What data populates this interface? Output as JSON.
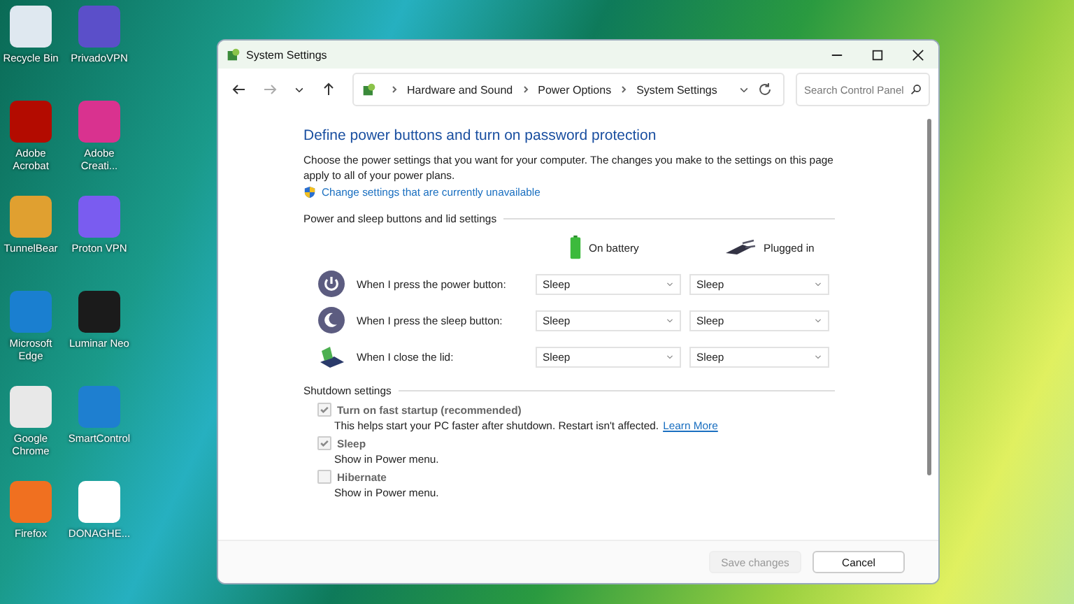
{
  "desktop": {
    "icons": [
      {
        "label": "Recycle Bin"
      },
      {
        "label": "PrivadoVPN"
      },
      {
        "label": "Adobe Acrobat"
      },
      {
        "label": "Adobe Creati..."
      },
      {
        "label": "TunnelBear"
      },
      {
        "label": "Proton VPN"
      },
      {
        "label": "Microsoft Edge"
      },
      {
        "label": "Luminar Neo"
      },
      {
        "label": "Google Chrome"
      },
      {
        "label": "SmartControl"
      },
      {
        "label": "Firefox"
      },
      {
        "label": "DONAGHE..."
      }
    ]
  },
  "window": {
    "title": "System Settings",
    "breadcrumb": [
      "Hardware and Sound",
      "Power Options",
      "System Settings"
    ],
    "search": {
      "placeholder": "Search Control Panel"
    },
    "heading": "Define power buttons and turn on password protection",
    "intro": "Choose the power settings that you want for your computer. The changes you make to the settings on this page apply to all of your power plans.",
    "admin_link": "Change settings that are currently unavailable",
    "power_section": {
      "title": "Power and sleep buttons and lid settings",
      "columns": [
        {
          "label": "On battery"
        },
        {
          "label": "Plugged in"
        }
      ],
      "rows": [
        {
          "kind": "power",
          "label": "When I press the power button:",
          "values": [
            "Sleep",
            "Sleep"
          ]
        },
        {
          "kind": "sleep",
          "label": "When I press the sleep button:",
          "values": [
            "Sleep",
            "Sleep"
          ]
        },
        {
          "kind": "lid",
          "label": "When I close the lid:",
          "values": [
            "Sleep",
            "Sleep"
          ]
        }
      ]
    },
    "shutdown_section": {
      "title": "Shutdown settings",
      "options": [
        {
          "label": "Turn on fast startup (recommended)",
          "description": "This helps start your PC faster after shutdown. Restart isn't affected.",
          "link": "Learn More",
          "checked": true,
          "disabled": true
        },
        {
          "label": "Sleep",
          "description": "Show in Power menu.",
          "checked": true,
          "disabled": true
        },
        {
          "label": "Hibernate",
          "description": "Show in Power menu.",
          "checked": false,
          "disabled": true
        }
      ]
    },
    "buttons": [
      {
        "label": "Save changes",
        "disabled": true
      },
      {
        "label": "Cancel",
        "disabled": false
      }
    ]
  }
}
